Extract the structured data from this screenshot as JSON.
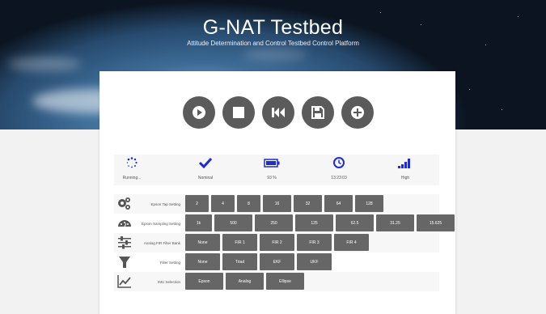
{
  "header": {
    "title": "G-NAT Testbed",
    "subtitle": "Attitude Determination and Control Testbed Control Platform"
  },
  "controls": [
    {
      "name": "play-icon"
    },
    {
      "name": "stop-icon"
    },
    {
      "name": "rewind-icon"
    },
    {
      "name": "save-icon"
    },
    {
      "name": "add-icon"
    }
  ],
  "status": {
    "running": {
      "label": "Running...",
      "icon": "spinner-icon"
    },
    "state": {
      "label": "Nominal",
      "icon": "check-icon"
    },
    "battery": {
      "label": "93 %",
      "icon": "battery-icon"
    },
    "time": {
      "label": "13:23:03",
      "icon": "clock-icon"
    },
    "signal": {
      "label": "High",
      "icon": "signal-icon"
    }
  },
  "settings": {
    "tap": {
      "label": "Epson Tap Setting",
      "options": [
        "2",
        "4",
        "8",
        "16",
        "32",
        "64",
        "128"
      ]
    },
    "sampling": {
      "label": "Epson Sampling Setting",
      "options": [
        "1k",
        "500",
        "250",
        "125",
        "62.5",
        "31.25",
        "15.625"
      ]
    },
    "fir": {
      "label": "Analog FIR Filter Bank",
      "options": [
        "None",
        "FIR 1",
        "FIR 2",
        "FIR 3",
        "FIR 4"
      ]
    },
    "filter": {
      "label": "Filter Setting",
      "options": [
        "None",
        "Triad",
        "EKF",
        "UKF"
      ]
    },
    "imu": {
      "label": "IMU Selection",
      "options": [
        "Epson",
        "Analog",
        "Ellipse"
      ]
    }
  },
  "colors": {
    "accent": "#1f2bd6",
    "button": "#5b5b5b",
    "option": "#666666"
  }
}
